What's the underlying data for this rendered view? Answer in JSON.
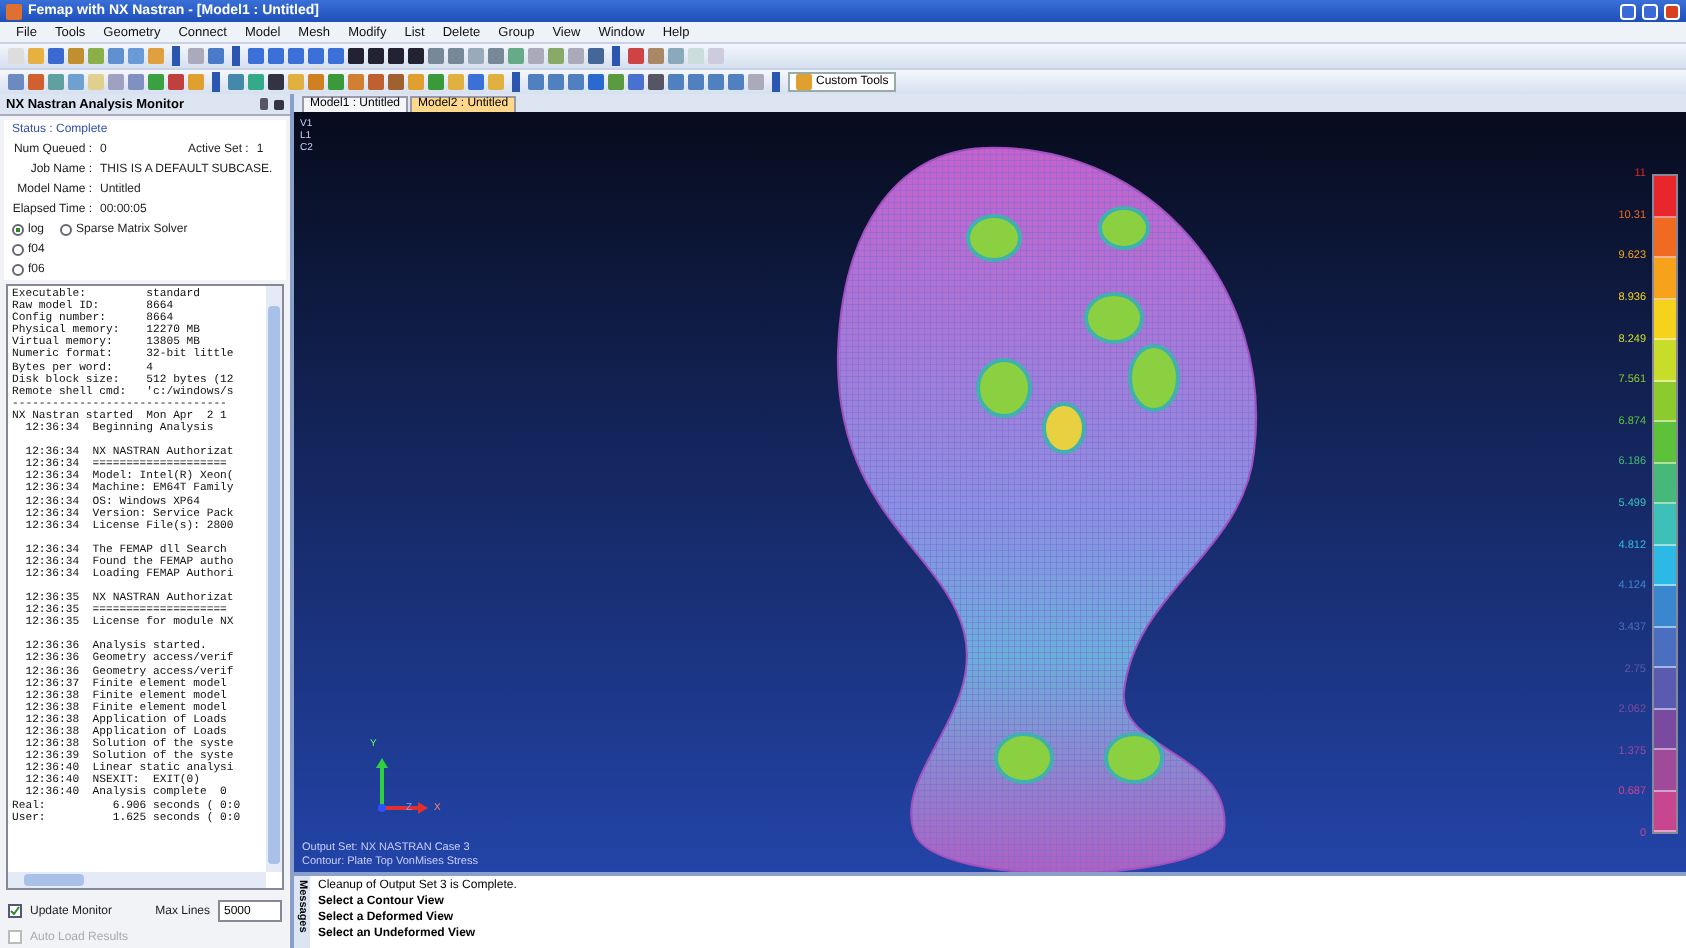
{
  "window": {
    "title": "Femap with NX Nastran - [Model1 : Untitled]"
  },
  "menu": [
    "File",
    "Tools",
    "Geometry",
    "Connect",
    "Model",
    "Mesh",
    "Modify",
    "List",
    "Delete",
    "Group",
    "View",
    "Window",
    "Help"
  ],
  "toolbar": {
    "custom_tools": "Custom Tools"
  },
  "monitor": {
    "title": "NX Nastran Analysis Monitor",
    "status": "Status : Complete",
    "num_queued_label": "Num Queued :",
    "num_queued": "0",
    "active_set_label": "Active Set :",
    "active_set": "1",
    "fields": [
      {
        "label": "Job Name :",
        "value": "THIS IS A DEFAULT SUBCASE."
      },
      {
        "label": "Model Name :",
        "value": "Untitled"
      },
      {
        "label": "Elapsed Time :",
        "value": "00:00:05"
      }
    ],
    "files": [
      {
        "label": "log",
        "selected": true
      },
      {
        "label": "Sparse Matrix Solver",
        "selected": false
      },
      {
        "label": "f04",
        "selected": false
      },
      {
        "label": "f06",
        "selected": false
      }
    ],
    "log": [
      [
        "Executable:         standard",
        "Raw model ID:       8664",
        "Config number:      8664",
        "Physical memory:    12270 MB",
        "Virtual memory:     13805 MB",
        "Numeric format:     32-bit little",
        "Bytes per word:     4",
        "Disk block size:    512 bytes (12",
        "Remote shell cmd:   'c:/windows/s",
        "--------------------------------",
        "NX Nastran started  Mon Apr  2 1",
        "  12:36:34  Beginning Analysis"
      ],
      [
        "  12:36:34  NX NASTRAN Authorizat",
        "  12:36:34  ====================",
        "  12:36:34  Model: Intel(R) Xeon(",
        "  12:36:34  Machine: EM64T Family",
        "  12:36:34  OS: Windows XP64",
        "  12:36:34  Version: Service Pack",
        "  12:36:34  License File(s): 2800"
      ],
      [
        "  12:36:34  The FEMAP dll Search",
        "  12:36:34  Found the FEMAP autho",
        "  12:36:34  Loading FEMAP Authori"
      ],
      [
        "  12:36:35  NX NASTRAN Authorizat",
        "  12:36:35  ====================",
        "  12:36:35  License for module NX"
      ],
      [
        "  12:36:36  Analysis started.",
        "  12:36:36  Geometry access/verif",
        "  12:36:36  Geometry access/verif",
        "  12:36:37  Finite element model",
        "  12:36:38  Finite element model",
        "  12:36:38  Finite element model",
        "  12:36:38  Application of Loads",
        "  12:36:38  Application of Loads",
        "  12:36:38  Solution of the syste",
        "  12:36:39  Solution of the syste",
        "  12:36:40  Linear static analysi",
        "  12:36:40  NSEXIT:  EXIT(0)",
        "  12:36:40  Analysis complete  0",
        "Real:          6.906 seconds ( 0:0",
        "User:          1.625 seconds ( 0:0"
      ]
    ],
    "update_monitor": {
      "label": "Update Monitor",
      "checked": true
    },
    "max_lines": {
      "label": "Max Lines",
      "value": "5000"
    },
    "auto_load": {
      "label": "Auto Load Results",
      "checked": false,
      "disabled": true
    }
  },
  "viewport": {
    "tabs": [
      {
        "label": "Model1 : Untitled",
        "selected": false
      },
      {
        "label": "Model2 : Untitled",
        "selected": true
      }
    ],
    "corner": [
      "V1",
      "L1",
      "C2"
    ],
    "output": [
      "Output Set: NX NASTRAN Case 3",
      "Contour: Plate Top VonMises Stress"
    ],
    "axes": [
      "Y",
      "X",
      "Z"
    ],
    "legend": {
      "levels": [
        "11",
        "10.31",
        "9.623",
        "8.936",
        "8.249",
        "7.561",
        "6.874",
        "6.186",
        "5.499",
        "4.812",
        "4.124",
        "3.437",
        "2.75",
        "2.062",
        "1.375",
        "0.687",
        "0"
      ],
      "bands": [
        {
          "color": "#e8262b"
        },
        {
          "color": "#f06a22"
        },
        {
          "color": "#f7a21b"
        },
        {
          "color": "#f5d31c"
        },
        {
          "color": "#c7dd2a"
        },
        {
          "color": "#8ccb2e"
        },
        {
          "color": "#5cc23a"
        },
        {
          "color": "#45b87a"
        },
        {
          "color": "#3dc0b7"
        },
        {
          "color": "#2db9e6"
        },
        {
          "color": "#3a87d0"
        },
        {
          "color": "#4a6fc0"
        },
        {
          "color": "#5a5ab0"
        },
        {
          "color": "#7a4aa0"
        },
        {
          "color": "#a04a9a"
        },
        {
          "color": "#c8468f"
        }
      ]
    }
  },
  "messages": {
    "title": "Messages",
    "items": [
      {
        "text": "Cleanup of Output Set 3 is Complete.",
        "bold": false
      },
      {
        "text": "Select a Contour View",
        "bold": true
      },
      {
        "text": "Select a Deformed View",
        "bold": true
      },
      {
        "text": "Select an Undeformed View",
        "bold": true
      }
    ]
  }
}
